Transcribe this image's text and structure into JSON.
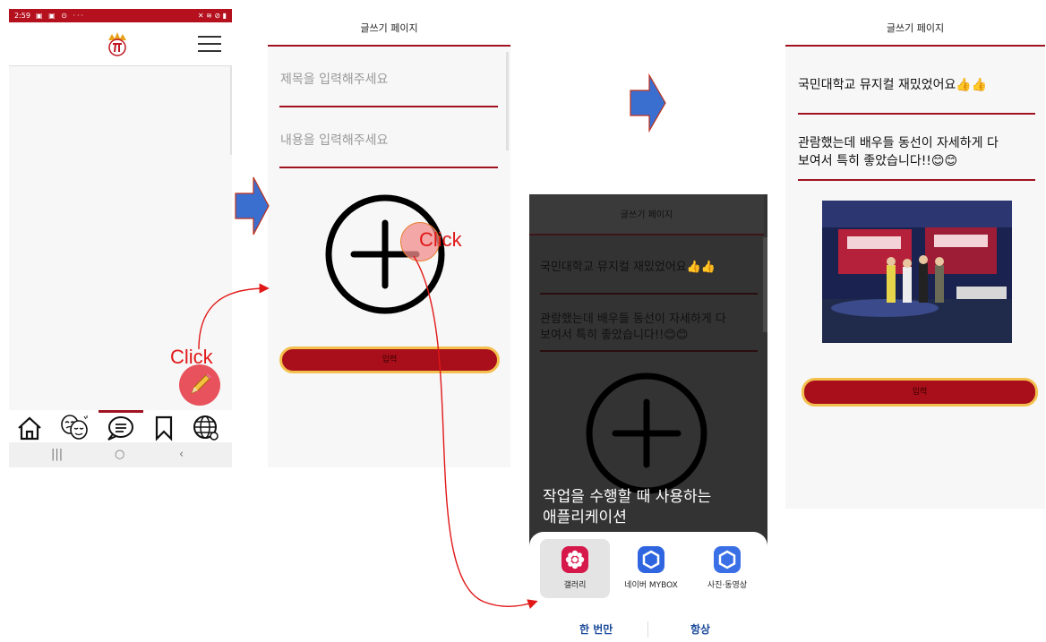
{
  "screen1": {
    "status_time": "2:59",
    "status_icons": "▣ ▣ ⊙ ···",
    "status_right": "✕ ≋ ⊘ ▮",
    "nav_items": [
      {
        "icon": "home-icon"
      },
      {
        "icon": "theater-masks-icon"
      },
      {
        "icon": "chat-bubble-icon"
      },
      {
        "icon": "bookmark-icon"
      },
      {
        "icon": "globe-icon"
      }
    ],
    "sysnav": [
      "|||",
      "○",
      "‹"
    ],
    "fab_icon": "pencil-icon"
  },
  "screen2": {
    "header_title": "글쓰기 페이지",
    "title_placeholder": "제목을 입력해주세요",
    "content_placeholder": "내용을 입력해주세요",
    "add_image_icon": "plus-circle-icon",
    "submit_label": "입력"
  },
  "screen3": {
    "header_title": "글쓰기 페이지",
    "title_text": "국민대학교 뮤지컬 재밌었어요👍👍",
    "content_text_line1": "관람했는데 배우들 동선이 자세하게 다",
    "content_text_line2": "보여서 특히 좋았습니다!!😊😊",
    "chooser_title_line1": "작업을 수행할 때 사용하는",
    "chooser_title_line2": "애플리케이션",
    "apps": [
      {
        "label": "갤러리",
        "color": "#d6194a"
      },
      {
        "label": "네이버 MYBOX",
        "color": "#2f66e0"
      },
      {
        "label": "사진·동영상",
        "color": "#3a6fe6"
      }
    ],
    "option_once": "한 번만",
    "option_always": "항상"
  },
  "screen4": {
    "header_title": "글쓰기 페이지",
    "title_text": "국민대학교 뮤지컬 재밌었어요👍👍",
    "content_text_line1": "관람했는데 배우들 동선이 자세하게 다",
    "content_text_line2": "보여서 특히 좋았습니다!!😊😊",
    "submit_label": "입력"
  },
  "annotations": {
    "click_1": "Click",
    "click_2": "Click",
    "arrow_color": "#3a6fd0",
    "curve_color": "#e11818"
  },
  "colors": {
    "brand_red": "#a01220",
    "button_border": "#f3c04e",
    "fab": "#e8525c"
  }
}
